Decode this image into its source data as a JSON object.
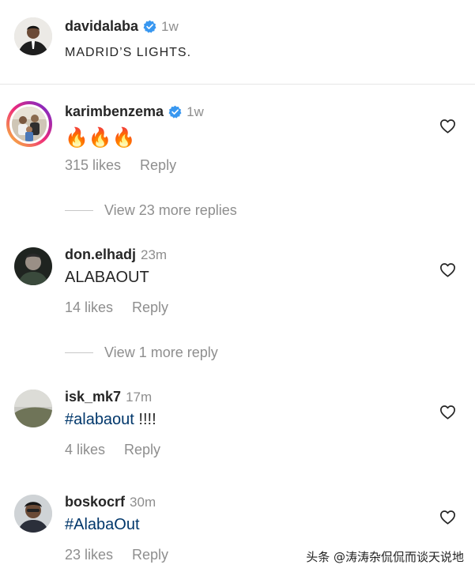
{
  "caption": {
    "username": "davidalaba",
    "time": "1w",
    "text": "MADRID’S LIGHTS."
  },
  "comments": [
    {
      "username": "karimbenzema",
      "verified": true,
      "time": "1w",
      "text": "🔥🔥🔥",
      "likes": "315 likes",
      "reply": "Reply",
      "view_more": "View 23 more replies"
    },
    {
      "username": "don.elhadj",
      "verified": false,
      "time": "23m",
      "text": "ALABAOUT",
      "likes": "14 likes",
      "reply": "Reply",
      "view_more": "View 1 more reply"
    },
    {
      "username": "isk_mk7",
      "verified": false,
      "time": "17m",
      "text_tag": "#alabaout",
      "text_rest": " !!!!",
      "likes": "4 likes",
      "reply": "Reply"
    },
    {
      "username": "boskocrf",
      "verified": false,
      "time": "30m",
      "text_tag": "#AlabaOut",
      "likes": "23 likes",
      "reply": "Reply"
    }
  ],
  "watermark": "头条 @涛涛杂侃侃而谈天说地",
  "icons": {
    "verified": "verified-badge-icon",
    "like": "heart-outline-icon"
  },
  "colors": {
    "verified_blue": "#3897f0",
    "hashtag": "#00376b",
    "secondary_text": "#8e8e8e"
  }
}
